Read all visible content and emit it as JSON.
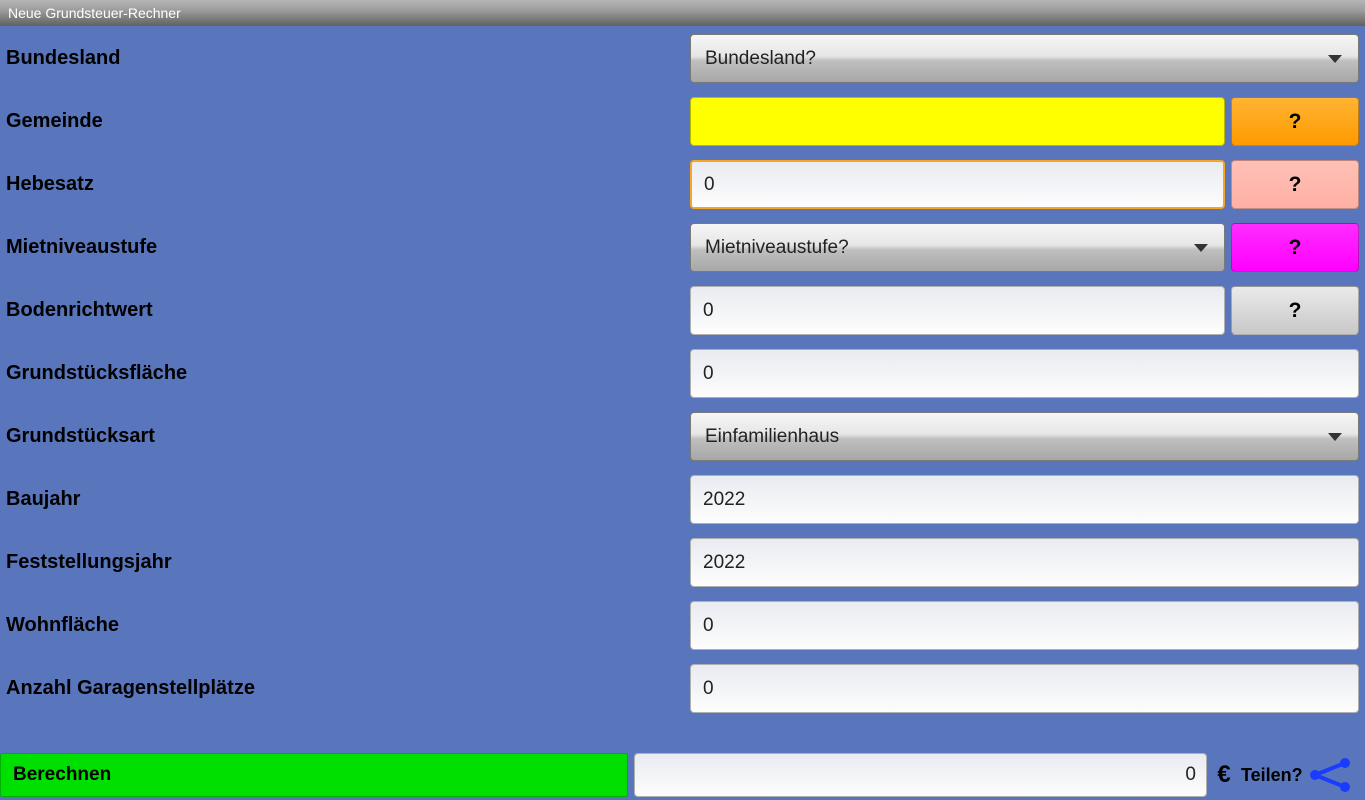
{
  "title": "Neue Grundsteuer-Rechner",
  "rows": {
    "bundesland": {
      "label": "Bundesland",
      "placeholder": "Bundesland?"
    },
    "gemeinde": {
      "label": "Gemeinde",
      "value": "",
      "help": "?"
    },
    "hebesatz": {
      "label": "Hebesatz",
      "value": "0",
      "help": "?"
    },
    "mietniveau": {
      "label": "Mietniveaustufe",
      "placeholder": "Mietniveaustufe?",
      "help": "?"
    },
    "boden": {
      "label": "Bodenrichtwert",
      "value": "0",
      "help": "?"
    },
    "flaeche": {
      "label": "Grundstücksfläche",
      "value": "0"
    },
    "art": {
      "label": "Grundstücksart",
      "selected": "Einfamilienhaus"
    },
    "baujahr": {
      "label": "Baujahr",
      "value": "2022"
    },
    "feststellung": {
      "label": "Feststellungsjahr",
      "value": "2022"
    },
    "wohnflaeche": {
      "label": "Wohnfläche",
      "value": "0"
    },
    "garagen": {
      "label": "Anzahl Garagenstellplätze",
      "value": "0"
    }
  },
  "bottom": {
    "calc": "Berechnen",
    "result": "0",
    "euro": "€",
    "share": "Teilen?"
  },
  "colors": {
    "background": "#5975bb",
    "help_orange": "#ff9a00",
    "help_pink": "#ffb0a4",
    "help_magenta": "#ff00ff",
    "help_grey": "#c8c8c8",
    "calc_green": "#00e000",
    "share_blue": "#1a3cff"
  }
}
